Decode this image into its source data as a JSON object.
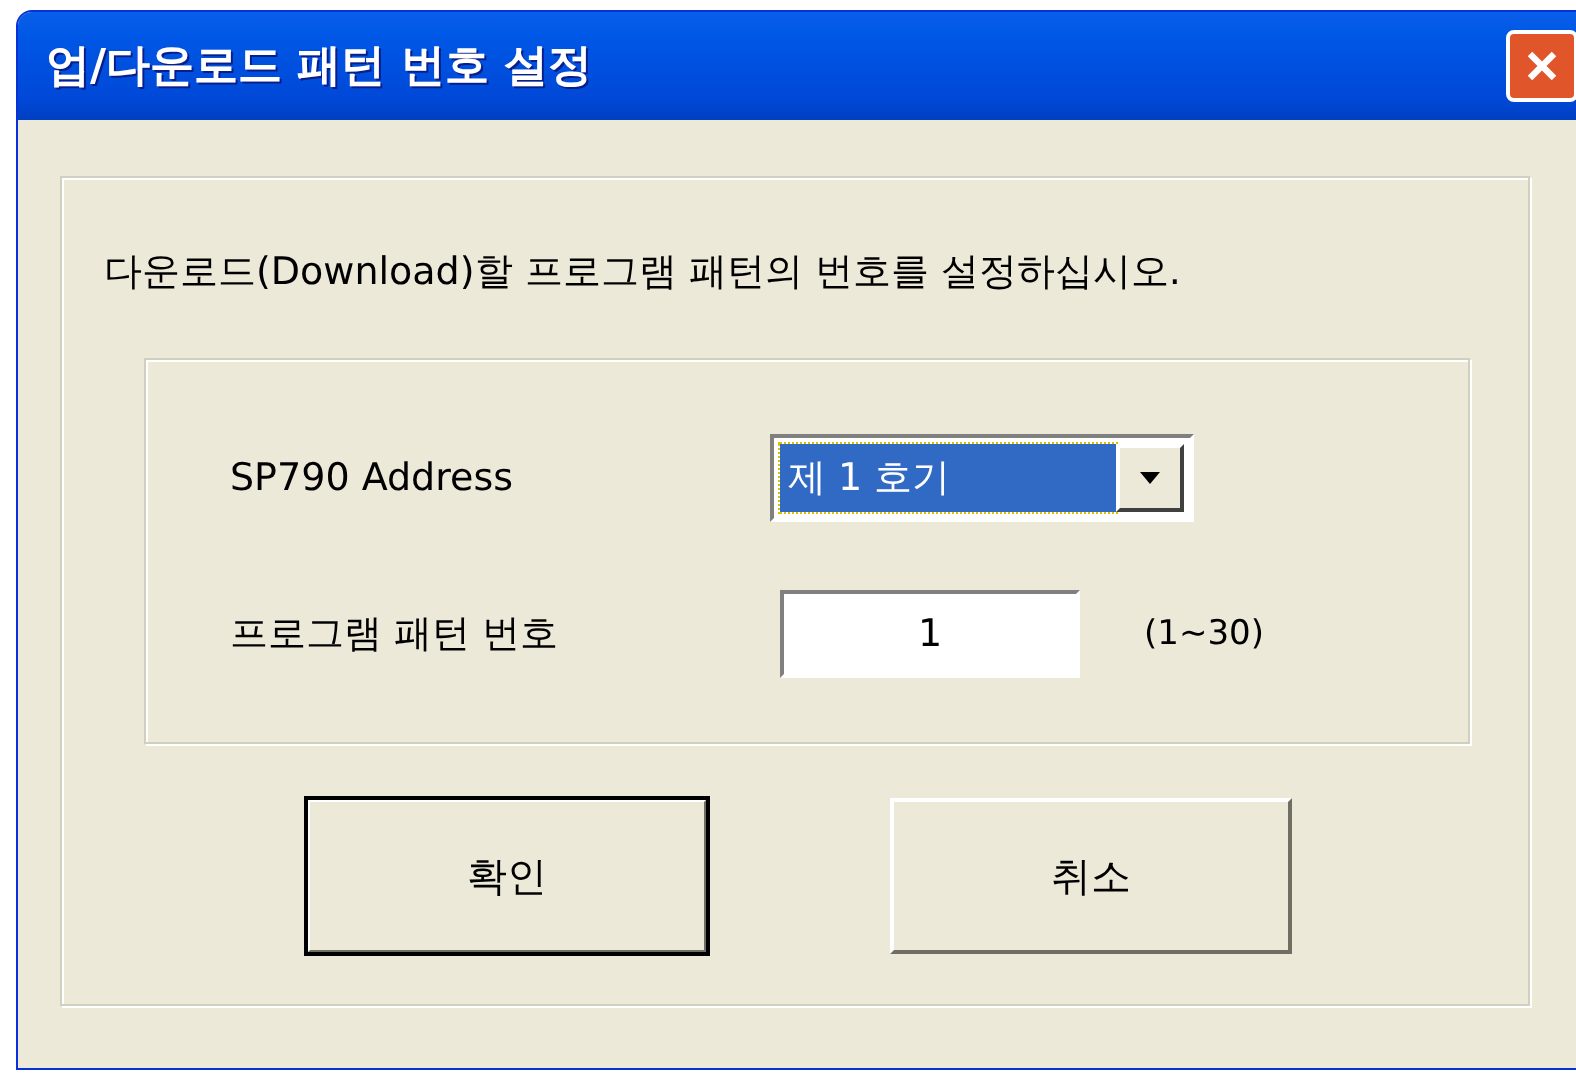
{
  "window": {
    "title": "업/다운로드 패턴 번호 설정"
  },
  "message": "다운로드(Download)할 프로그램 패턴의 번호를 설정하십시오.",
  "fields": [
    {
      "kind": "combo",
      "label": "SP790 Address",
      "value": "제 1 호기",
      "selected": true
    },
    {
      "kind": "text",
      "label": "프로그램 패턴 번호",
      "value": "1",
      "range": "(1~30)"
    }
  ],
  "buttons": [
    {
      "label": "확인",
      "default": true
    },
    {
      "label": "취소",
      "default": false
    }
  ]
}
